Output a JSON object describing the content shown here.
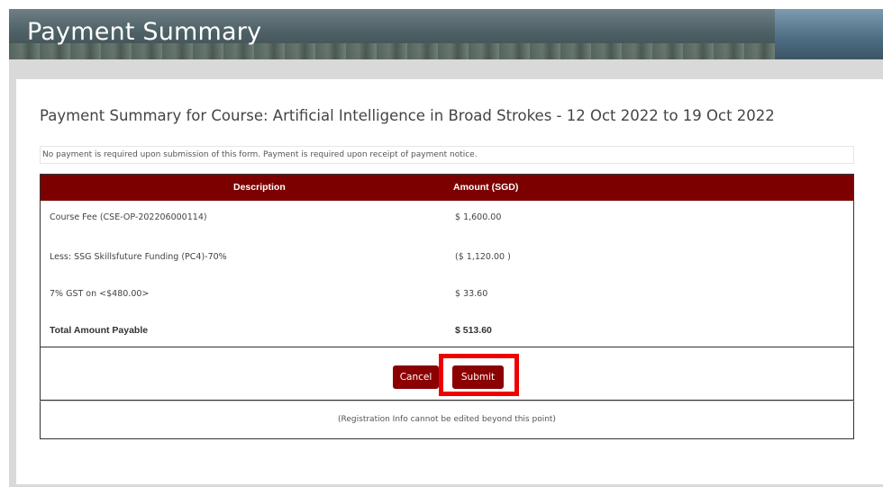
{
  "banner": {
    "title": "Payment Summary"
  },
  "course_heading": "Payment Summary for Course: Artificial Intelligence in Broad Strokes - 12 Oct 2022 to 19 Oct 2022",
  "notice": "No payment is required upon submission of this form. Payment is required upon receipt of payment notice.",
  "table": {
    "headers": {
      "description": "Description",
      "amount": "Amount (SGD)"
    },
    "rows": [
      {
        "description": "Course Fee (CSE-OP-202206000114)",
        "amount": "$ 1,600.00"
      },
      {
        "description": "Less: SSG Skillsfuture Funding (PC4)-70%",
        "amount": "($ 1,120.00 )"
      },
      {
        "description": "7% GST on <$480.00>",
        "amount": "$ 33.60"
      },
      {
        "description": "Total Amount Payable",
        "amount": "$ 513.60"
      }
    ]
  },
  "actions": {
    "cancel_label": "Cancel",
    "submit_label": "Submit"
  },
  "info_note": "(Registration Info cannot be edited beyond this point)",
  "colors": {
    "accent": "#8b0000",
    "header_bg": "#7d0000",
    "highlight": "#ee0000"
  }
}
